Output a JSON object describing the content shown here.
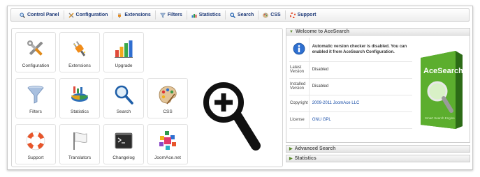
{
  "toolbar": {
    "items": [
      {
        "label": "Control Panel",
        "icon": "magnifier-icon"
      },
      {
        "label": "Configuration",
        "icon": "tools-icon"
      },
      {
        "label": "Extensions",
        "icon": "plug-icon"
      },
      {
        "label": "Filters",
        "icon": "funnel-icon"
      },
      {
        "label": "Statistics",
        "icon": "chart-icon"
      },
      {
        "label": "Search",
        "icon": "search-icon"
      },
      {
        "label": "CSS",
        "icon": "palette-icon"
      },
      {
        "label": "Support",
        "icon": "lifebuoy-icon"
      }
    ]
  },
  "tiles": [
    {
      "label": "Configuration",
      "icon": "tools-icon"
    },
    {
      "label": "Extensions",
      "icon": "plug-icon"
    },
    {
      "label": "Upgrade",
      "icon": "bar-chart-icon"
    },
    {
      "label": "Filters",
      "icon": "funnel-icon"
    },
    {
      "label": "Statistics",
      "icon": "pie-chart-icon"
    },
    {
      "label": "Search",
      "icon": "magnifier-icon"
    },
    {
      "label": "CSS",
      "icon": "palette-icon"
    },
    {
      "label": "Support",
      "icon": "lifebuoy-icon"
    },
    {
      "label": "Translators",
      "icon": "flag-icon"
    },
    {
      "label": "Changelog",
      "icon": "terminal-icon"
    },
    {
      "label": "JoomAce.net",
      "icon": "ja-logo-icon"
    }
  ],
  "panel": {
    "title": "Welcome to AceSearch",
    "notice": "Automatic version checker is disabled. You can enabled it from AceSearch Configuration.",
    "rows": [
      {
        "key": "Latest Version",
        "value": "Disabled"
      },
      {
        "key": "Installed Version",
        "value": "Disabled"
      },
      {
        "key": "Copyright",
        "value": "2009-2011 JoomAce LLC"
      },
      {
        "key": "License",
        "value": "GNU GPL"
      }
    ],
    "boxshot_title": "AceSearch",
    "boxshot_subtitle": "Smart Search Engine"
  },
  "accordion": {
    "advanced": "Advanced Search",
    "statistics": "Statistics"
  },
  "colors": {
    "toolbar_text": "#1e3a78",
    "link": "#1a4fa8",
    "box_green": "#58a82e"
  }
}
